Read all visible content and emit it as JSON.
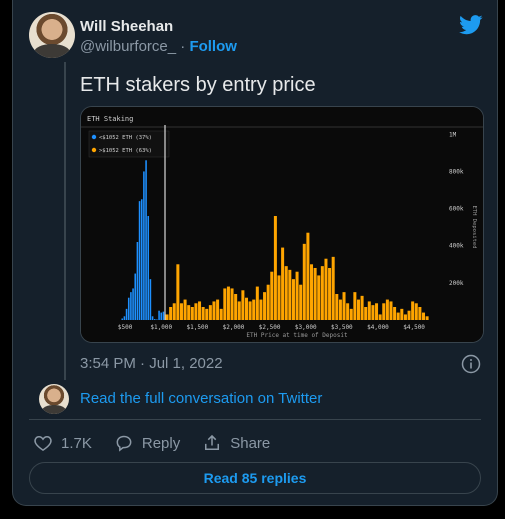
{
  "author": {
    "name": "Will Sheehan",
    "handle": "@wilburforce_",
    "separator": "·",
    "follow_label": "Follow"
  },
  "tweet": {
    "text": "ETH stakers by entry price",
    "timestamp": "3:54 PM · Jul 1, 2022"
  },
  "links": {
    "read_conversation": "Read the full conversation on Twitter",
    "read_replies": "Read 85 replies"
  },
  "actions": {
    "likes": "1.7K",
    "reply_label": "Reply",
    "share_label": "Share"
  },
  "colors": {
    "background": "#15202b",
    "accent": "#1d9bf0",
    "series_below": "#1e90ff",
    "series_above": "#ffa500"
  },
  "icons": [
    "twitter-bird-icon",
    "info-icon",
    "heart-icon",
    "reply-icon",
    "share-icon"
  ],
  "chart_data": {
    "type": "bar",
    "title": "ETH Staking",
    "xlabel": "ETH Price at time of Deposit",
    "ylabel": "ETH Deposited",
    "x_ticks": [
      "$500",
      "$1,000",
      "$1,500",
      "$2,000",
      "$2,500",
      "$3,000",
      "$3,500",
      "$4,000",
      "$4,500"
    ],
    "x_tick_values": [
      500,
      1000,
      1500,
      2000,
      2500,
      3000,
      3500,
      4000,
      4500
    ],
    "y_ticks": [
      "1M",
      "800k",
      "600k",
      "400k",
      "200k"
    ],
    "y_tick_values": [
      1000000,
      800000,
      600000,
      400000,
      200000
    ],
    "xlim": [
      0,
      4900
    ],
    "ylim": [
      0,
      1050000
    ],
    "threshold": 1052,
    "legend": [
      "<$1052 ETH (37%)",
      ">$1052 ETH (63%)"
    ],
    "legend_position": "top-left",
    "series": [
      {
        "name": "<$1052 ETH (37%)",
        "color": "#1e90ff",
        "x": [
          460,
          490,
          520,
          550,
          580,
          610,
          640,
          670,
          700,
          730,
          760,
          790,
          820,
          850,
          880,
          910,
          940,
          970,
          1000,
          1030
        ],
        "values": [
          8000,
          20000,
          60000,
          120000,
          150000,
          170000,
          250000,
          420000,
          640000,
          650000,
          800000,
          860000,
          560000,
          220000,
          20000,
          5000,
          3000,
          50000,
          40000,
          45000
        ]
      },
      {
        "name": ">$1052 ETH (63%)",
        "color": "#ffa500",
        "x": [
          1080,
          1130,
          1180,
          1230,
          1280,
          1330,
          1380,
          1430,
          1480,
          1530,
          1580,
          1630,
          1680,
          1730,
          1780,
          1830,
          1880,
          1930,
          1980,
          2030,
          2080,
          2130,
          2180,
          2230,
          2280,
          2330,
          2380,
          2430,
          2480,
          2530,
          2580,
          2630,
          2680,
          2730,
          2780,
          2830,
          2880,
          2930,
          2980,
          3030,
          3080,
          3130,
          3180,
          3230,
          3280,
          3330,
          3380,
          3430,
          3480,
          3530,
          3580,
          3630,
          3680,
          3730,
          3780,
          3830,
          3880,
          3930,
          3980,
          4030,
          4080,
          4130,
          4180,
          4230,
          4280,
          4330,
          4380,
          4430,
          4480,
          4530,
          4580,
          4630,
          4680
        ],
        "values": [
          30000,
          70000,
          90000,
          300000,
          90000,
          110000,
          80000,
          70000,
          90000,
          100000,
          70000,
          60000,
          80000,
          100000,
          110000,
          60000,
          170000,
          180000,
          170000,
          140000,
          100000,
          160000,
          120000,
          100000,
          110000,
          180000,
          110000,
          150000,
          190000,
          260000,
          560000,
          240000,
          390000,
          290000,
          270000,
          220000,
          260000,
          190000,
          410000,
          470000,
          300000,
          280000,
          240000,
          290000,
          330000,
          280000,
          340000,
          140000,
          110000,
          150000,
          90000,
          60000,
          150000,
          110000,
          130000,
          70000,
          100000,
          80000,
          90000,
          30000,
          90000,
          110000,
          100000,
          70000,
          40000,
          60000,
          30000,
          50000,
          100000,
          90000,
          70000,
          40000,
          20000
        ]
      }
    ]
  }
}
